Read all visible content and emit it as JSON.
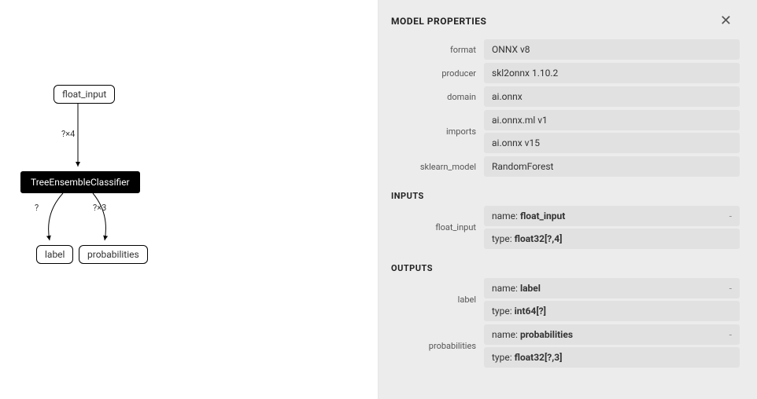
{
  "graph": {
    "nodes": {
      "input": {
        "label": "float_input"
      },
      "op": {
        "label": "TreeEnsembleClassifier"
      },
      "out_label": {
        "label": "label"
      },
      "out_prob": {
        "label": "probabilities"
      }
    },
    "edges": {
      "input_to_op": {
        "label": "?×4"
      },
      "op_to_label": {
        "label": "?"
      },
      "op_to_prob": {
        "label": "?×3"
      }
    }
  },
  "panel": {
    "title": "MODEL PROPERTIES",
    "sections": {
      "inputs_title": "INPUTS",
      "outputs_title": "OUTPUTS"
    },
    "model_properties": {
      "format": {
        "key": "format",
        "values": [
          "ONNX v8"
        ]
      },
      "producer": {
        "key": "producer",
        "values": [
          "skl2onnx 1.10.2"
        ]
      },
      "domain": {
        "key": "domain",
        "values": [
          "ai.onnx"
        ]
      },
      "imports": {
        "key": "imports",
        "values": [
          "ai.onnx.ml v1",
          "ai.onnx v15"
        ]
      },
      "sklearn_model": {
        "key": "sklearn_model",
        "values": [
          "RandomForest"
        ]
      }
    },
    "inputs": {
      "float_input": {
        "key": "float_input",
        "rows": [
          {
            "k": "name",
            "v": "float_input",
            "dash": true
          },
          {
            "k": "type",
            "v": "float32[?,4]"
          }
        ]
      }
    },
    "outputs": {
      "label": {
        "key": "label",
        "rows": [
          {
            "k": "name",
            "v": "label",
            "dash": true
          },
          {
            "k": "type",
            "v": "int64[?]"
          }
        ]
      },
      "probabilities": {
        "key": "probabilities",
        "rows": [
          {
            "k": "name",
            "v": "probabilities",
            "dash": true
          },
          {
            "k": "type",
            "v": "float32[?,3]"
          }
        ]
      }
    }
  }
}
